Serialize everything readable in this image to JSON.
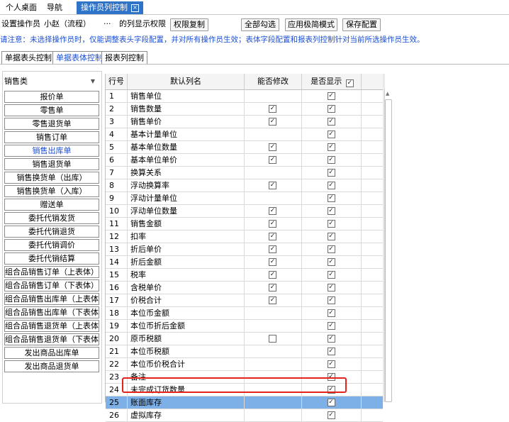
{
  "tabs": [
    {
      "label": "个人桌面"
    },
    {
      "label": "导航"
    },
    {
      "label": "操作员列控制",
      "active": true
    }
  ],
  "toolbar": {
    "operator_label": "设置操作员",
    "operator_value": "小赵（流程）",
    "ellipsis": "···",
    "permission_text": "的列显示权限",
    "copy_button": "权限复制",
    "select_all_button": "全部勾选",
    "simple_mode_button": "应用极简模式",
    "save_button": "保存配置"
  },
  "notice": "请注意：未选择操作员时，仅能调整表头字段配置，并对所有操作员生效；表体字段配置和报表列控制针对当前所选操作员生效。",
  "subtabs": [
    {
      "label": "单据表头控制"
    },
    {
      "label": "单据表体控制",
      "active": true
    },
    {
      "label": "报表列控制"
    }
  ],
  "category": {
    "value": "销售类"
  },
  "left_items": [
    "报价单",
    "零售单",
    "零售退货单",
    "销售订单",
    "销售出库单",
    "销售退货单",
    "销售换货单（出库）",
    "销售换货单（入库）",
    "赠送单",
    "委托代销发货",
    "委托代销退货",
    "委托代销调价",
    "委托代销结算",
    "组合品销售订单（上表体）",
    "组合品销售订单（下表体）",
    "组合品销售出库单（上表体）",
    "组合品销售出库单（下表体）",
    "组合品销售退货单（上表体）",
    "组合品销售退货单（下表体）",
    "发出商品出库单",
    "发出商品退货单"
  ],
  "left_active_index": 4,
  "table": {
    "headers": {
      "no": "行号",
      "name": "默认列名",
      "editable": "能否修改",
      "visible": "是否显示"
    },
    "header_visible_checked": true,
    "rows": [
      {
        "no": "1",
        "name": "销售单位",
        "edit": null,
        "show": true
      },
      {
        "no": "2",
        "name": "销售数量",
        "edit": true,
        "show": true
      },
      {
        "no": "3",
        "name": "销售单价",
        "edit": true,
        "show": true
      },
      {
        "no": "4",
        "name": "基本计量单位",
        "edit": null,
        "show": true
      },
      {
        "no": "5",
        "name": "基本单位数量",
        "edit": true,
        "show": true
      },
      {
        "no": "6",
        "name": "基本单位单价",
        "edit": true,
        "show": true
      },
      {
        "no": "7",
        "name": "换算关系",
        "edit": null,
        "show": true
      },
      {
        "no": "8",
        "name": "浮动换算率",
        "edit": true,
        "show": true
      },
      {
        "no": "9",
        "name": "浮动计量单位",
        "edit": null,
        "show": true
      },
      {
        "no": "10",
        "name": "浮动单位数量",
        "edit": true,
        "show": true
      },
      {
        "no": "11",
        "name": "销售金额",
        "edit": true,
        "show": true
      },
      {
        "no": "12",
        "name": "扣率",
        "edit": true,
        "show": true
      },
      {
        "no": "13",
        "name": "折后单价",
        "edit": true,
        "show": true
      },
      {
        "no": "14",
        "name": "折后金额",
        "edit": true,
        "show": true
      },
      {
        "no": "15",
        "name": "税率",
        "edit": true,
        "show": true
      },
      {
        "no": "16",
        "name": "含税单价",
        "edit": true,
        "show": true
      },
      {
        "no": "17",
        "name": "价税合计",
        "edit": true,
        "show": true
      },
      {
        "no": "18",
        "name": "本位币金额",
        "edit": null,
        "show": true
      },
      {
        "no": "19",
        "name": "本位币折后金额",
        "edit": null,
        "show": true
      },
      {
        "no": "20",
        "name": "原币税额",
        "edit": false,
        "show": true
      },
      {
        "no": "21",
        "name": "本位币税额",
        "edit": null,
        "show": true
      },
      {
        "no": "22",
        "name": "本位币价税合计",
        "edit": null,
        "show": true
      },
      {
        "no": "23",
        "name": "备注",
        "edit": null,
        "show": true
      },
      {
        "no": "24",
        "name": "未完成订货数量",
        "edit": null,
        "show": true
      },
      {
        "no": "25",
        "name": "账面库存",
        "edit": null,
        "show": true,
        "selected": true
      },
      {
        "no": "26",
        "name": "虚拟库存",
        "edit": null,
        "show": true
      }
    ]
  },
  "colors": {
    "accent": "#2f73c8",
    "notice": "#1d4fd0",
    "selected_row": "#7eb0e8",
    "highlight_box": "#e2231a"
  }
}
